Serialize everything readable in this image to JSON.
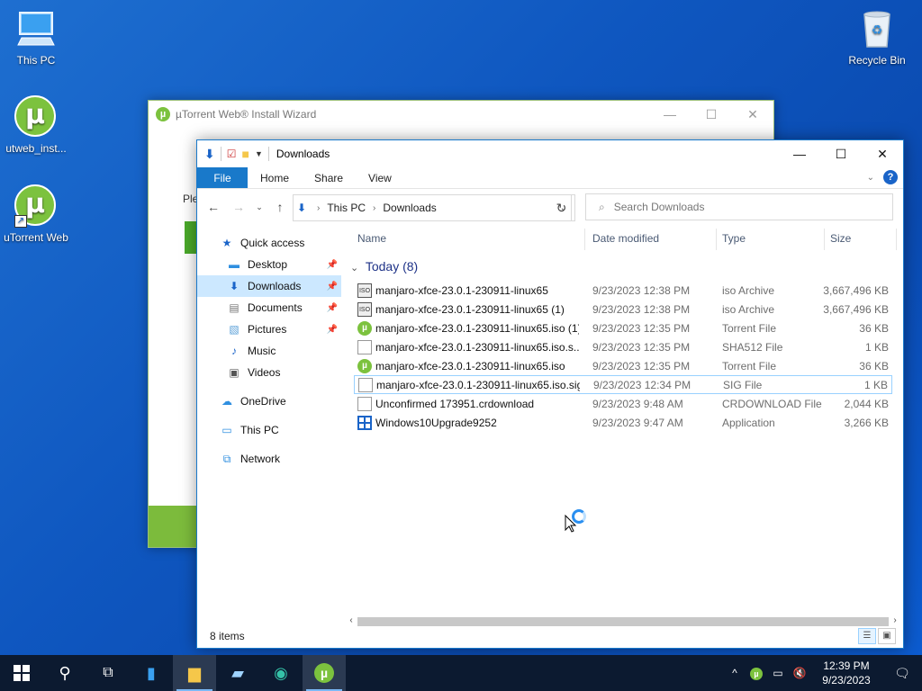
{
  "desktop": {
    "icons": [
      {
        "label": "This PC",
        "icon": "computer-icon"
      },
      {
        "label": "utweb_inst...",
        "icon": "utorrent-icon"
      },
      {
        "label": "uTorrent Web",
        "icon": "utorrent-icon"
      },
      {
        "label": "Recycle Bin",
        "icon": "recycle-bin-icon"
      }
    ]
  },
  "wizard": {
    "title": "µTorrent Web® Install Wizard",
    "body_text": "Ple",
    "accent": "#7cbb3c"
  },
  "explorer": {
    "title": "Downloads",
    "ribbon": {
      "file": "File",
      "tabs": [
        "Home",
        "Share",
        "View"
      ]
    },
    "address": {
      "crumbs": [
        "This PC",
        "Downloads"
      ]
    },
    "search": {
      "placeholder": "Search Downloads"
    },
    "nav": {
      "quick_access": "Quick access",
      "desktop": "Desktop",
      "downloads": "Downloads",
      "documents": "Documents",
      "pictures": "Pictures",
      "music": "Music",
      "videos": "Videos",
      "onedrive": "OneDrive",
      "thispc": "This PC",
      "network": "Network"
    },
    "columns": {
      "name": "Name",
      "date": "Date modified",
      "type": "Type",
      "size": "Size"
    },
    "group": "Today (8)",
    "files": [
      {
        "name": "manjaro-xfce-23.0.1-230911-linux65",
        "date": "9/23/2023 12:38 PM",
        "type": "iso Archive",
        "size": "3,667,496 KB",
        "icon": "iso"
      },
      {
        "name": "manjaro-xfce-23.0.1-230911-linux65 (1)",
        "date": "9/23/2023 12:38 PM",
        "type": "iso Archive",
        "size": "3,667,496 KB",
        "icon": "iso"
      },
      {
        "name": "manjaro-xfce-23.0.1-230911-linux65.iso (1)",
        "date": "9/23/2023 12:35 PM",
        "type": "Torrent File",
        "size": "36 KB",
        "icon": "torrent"
      },
      {
        "name": "manjaro-xfce-23.0.1-230911-linux65.iso.s...",
        "date": "9/23/2023 12:35 PM",
        "type": "SHA512 File",
        "size": "1 KB",
        "icon": "file"
      },
      {
        "name": "manjaro-xfce-23.0.1-230911-linux65.iso",
        "date": "9/23/2023 12:35 PM",
        "type": "Torrent File",
        "size": "36 KB",
        "icon": "torrent"
      },
      {
        "name": "manjaro-xfce-23.0.1-230911-linux65.iso.sig",
        "date": "9/23/2023 12:34 PM",
        "type": "SIG File",
        "size": "1 KB",
        "icon": "file"
      },
      {
        "name": "Unconfirmed 173951.crdownload",
        "date": "9/23/2023 9:48 AM",
        "type": "CRDOWNLOAD File",
        "size": "2,044 KB",
        "icon": "file"
      },
      {
        "name": "Windows10Upgrade9252",
        "date": "9/23/2023 9:47 AM",
        "type": "Application",
        "size": "3,266 KB",
        "icon": "windows"
      }
    ],
    "status": "8 items"
  },
  "taskbar": {
    "time": "12:39 PM",
    "date": "9/23/2023"
  },
  "colors": {
    "accent": "#1979ca",
    "selection": "#cce8ff",
    "utorrent": "#7cc23e"
  }
}
